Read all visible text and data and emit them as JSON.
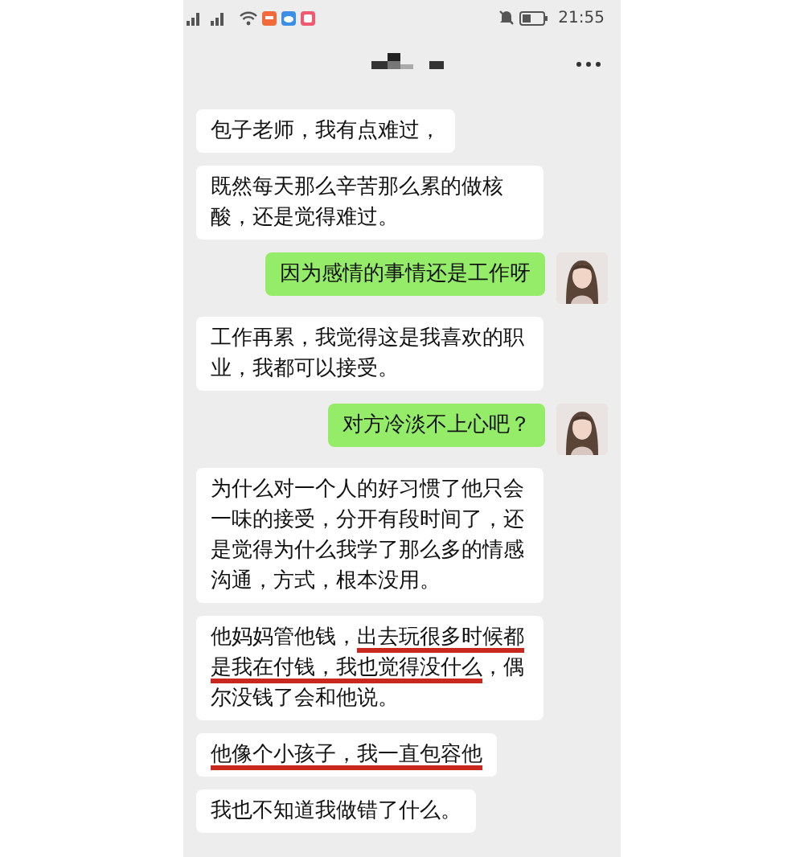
{
  "status_bar": {
    "time": "21:55"
  },
  "messages": [
    {
      "kind": "incoming",
      "parts": [
        {
          "text": "包子老师，我有点难过，",
          "underlined": false
        }
      ]
    },
    {
      "kind": "incoming",
      "parts": [
        {
          "text": "既然每天那么辛苦那么累的做核酸，还是觉得难过。",
          "underlined": false
        }
      ]
    },
    {
      "kind": "outgoing",
      "parts": [
        {
          "text": "因为感情的事情还是工作呀",
          "underlined": false
        }
      ]
    },
    {
      "kind": "incoming",
      "parts": [
        {
          "text": "工作再累，我觉得这是我喜欢的职业，我都可以接受。",
          "underlined": false
        }
      ]
    },
    {
      "kind": "outgoing",
      "parts": [
        {
          "text": "对方冷淡不上心吧？",
          "underlined": false
        }
      ]
    },
    {
      "kind": "incoming",
      "parts": [
        {
          "text": "为什么对一个人的好习惯了他只会一味的接受，分开有段时间了，还是觉得为什么我学了那么多的情感沟通，方式，根本没用。",
          "underlined": false
        }
      ]
    },
    {
      "kind": "incoming",
      "parts": [
        {
          "text": "他妈妈管他钱，",
          "underlined": false
        },
        {
          "text": "出去玩很多时候都是我在付钱，我也觉得没什么",
          "underlined": true
        },
        {
          "text": "，偶尔没钱了会和他说。",
          "underlined": false
        }
      ]
    },
    {
      "kind": "incoming",
      "parts": [
        {
          "text": "他像个小孩子，我一直包容他",
          "underlined": true
        }
      ]
    },
    {
      "kind": "incoming",
      "parts": [
        {
          "text": "我也不知道我做错了什么。"
        }
      ]
    }
  ]
}
